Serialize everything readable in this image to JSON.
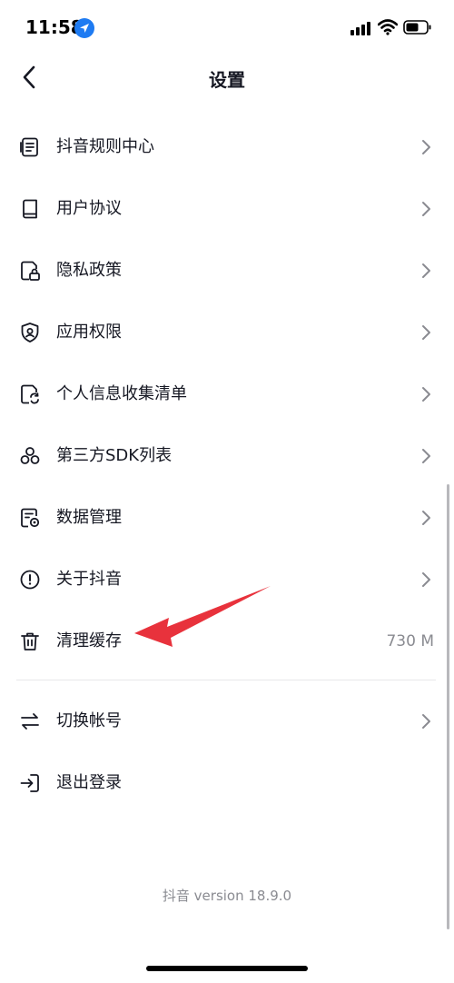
{
  "status_bar": {
    "time": "11:58"
  },
  "nav": {
    "title": "设置"
  },
  "menu": {
    "items": [
      {
        "label": "抖音规则中心",
        "icon": "document-list-icon"
      },
      {
        "label": "用户协议",
        "icon": "book-icon"
      },
      {
        "label": "隐私政策",
        "icon": "privacy-lock-icon"
      },
      {
        "label": "应用权限",
        "icon": "shield-icon"
      },
      {
        "label": "个人信息收集清单",
        "icon": "document-refresh-icon"
      },
      {
        "label": "第三方SDK列表",
        "icon": "sdk-nodes-icon"
      },
      {
        "label": "数据管理",
        "icon": "data-settings-icon"
      },
      {
        "label": "关于抖音",
        "icon": "info-circle-icon"
      },
      {
        "label": "清理缓存",
        "icon": "trash-icon",
        "value": "730 M"
      }
    ],
    "account_items": [
      {
        "label": "切换帐号",
        "icon": "switch-arrows-icon"
      },
      {
        "label": "退出登录",
        "icon": "logout-icon"
      }
    ]
  },
  "footer": {
    "version": "抖音 version 18.9.0"
  },
  "colors": {
    "annotation_arrow": "#e8323c",
    "text": "#161823",
    "secondary_text": "#8a8b91"
  }
}
